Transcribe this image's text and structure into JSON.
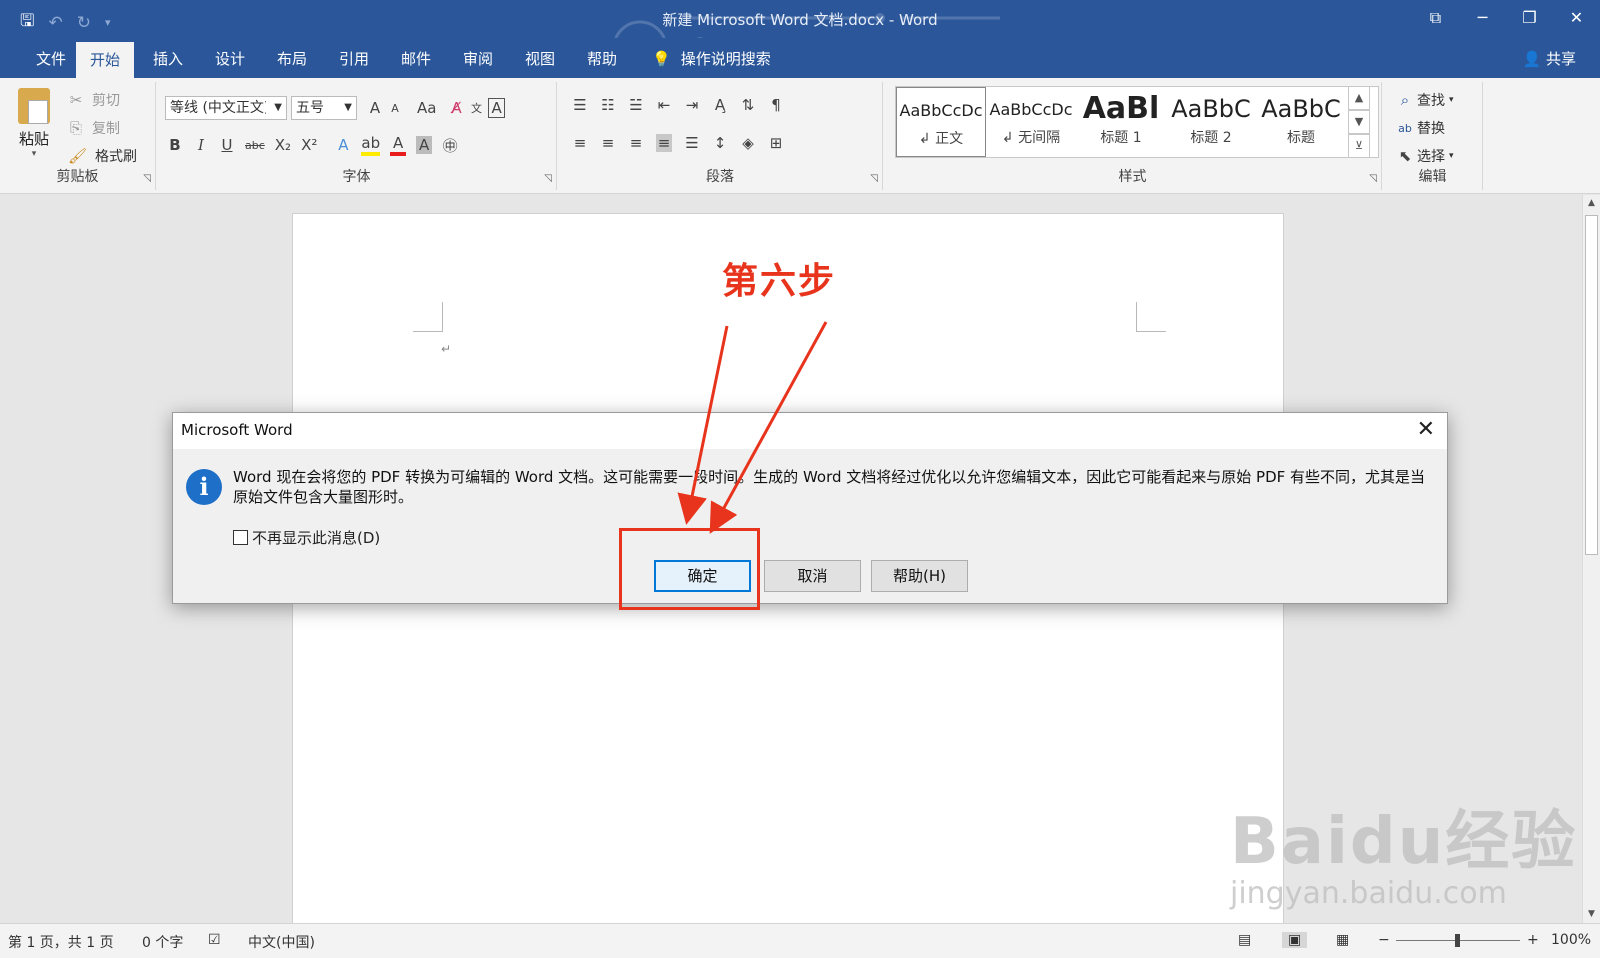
{
  "window": {
    "title": "新建 Microsoft Word 文档.docx  -  Word",
    "qat": [
      "save-icon",
      "undo-icon",
      "redo-icon",
      "customize-icon"
    ]
  },
  "tabs": [
    "文件",
    "开始",
    "插入",
    "设计",
    "布局",
    "引用",
    "邮件",
    "审阅",
    "视图",
    "帮助"
  ],
  "active_tab": "开始",
  "tell_me": "操作说明搜索",
  "share": "共享",
  "clipboard": {
    "paste": "粘贴",
    "cut": "剪切",
    "copy": "复制",
    "format_painter": "格式刷",
    "label": "剪贴板"
  },
  "font": {
    "name": "等线 (中文正文)",
    "size": "五号",
    "label": "字体",
    "grow": "A",
    "shrink": "A",
    "case": "Aa"
  },
  "paragraph": {
    "label": "段落"
  },
  "styles": {
    "label": "样式",
    "items": [
      {
        "sample": "AaBbCcDc",
        "name": "↲ 正文"
      },
      {
        "sample": "AaBbCcDc",
        "name": "↲ 无间隔"
      },
      {
        "sample": "AaBl",
        "name": "标题 1"
      },
      {
        "sample": "AaBbC",
        "name": "标题 2"
      },
      {
        "sample": "AaBbC",
        "name": "标题"
      }
    ]
  },
  "editing": {
    "find": "查找",
    "replace": "替换",
    "select": "选择",
    "label": "编辑"
  },
  "annotation": "第六步",
  "dialog": {
    "title": "Microsoft Word",
    "message": "Word 现在会将您的 PDF 转换为可编辑的 Word 文档。这可能需要一段时间。生成的 Word 文档将经过优化以允许您编辑文本，因此它可能看起来与原始 PDF 有些不同，尤其是当原始文件包含大量图形时。",
    "checkbox": "不再显示此消息(D)",
    "ok": "确定",
    "cancel": "取消",
    "help": "帮助(H)"
  },
  "status": {
    "page": "第 1 页，共 1 页",
    "words": "0 个字",
    "language": "中文(中国)",
    "zoom": "100%"
  },
  "watermark": {
    "logo": "Baidu经验",
    "url": "jingyan.baidu.com"
  },
  "colors": {
    "brand": "#2b579a",
    "annotation": "#e8341c",
    "dialog_accent": "#0078d7"
  }
}
